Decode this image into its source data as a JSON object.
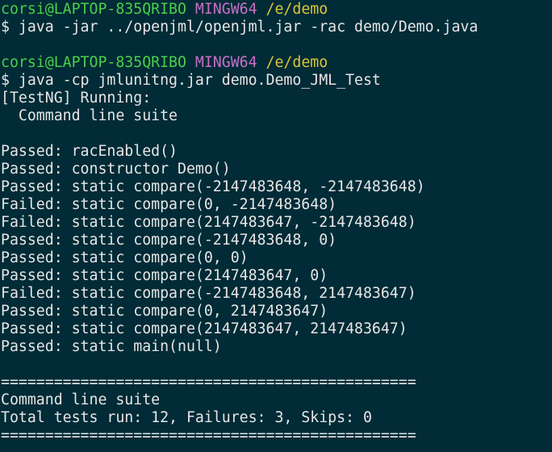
{
  "window": {
    "background": "#012b36",
    "colors": {
      "user": "#4ad04a",
      "env": "#c76fc7",
      "path": "#d9c63a",
      "text": "#e6e6e6"
    }
  },
  "prompt1": {
    "user": "corsi@LAPTOP-835QRIBO",
    "env": "MINGW64",
    "path": "/e/demo",
    "command": "$ java -jar ../openjml/openjml.jar -rac demo/Demo.java"
  },
  "prompt2": {
    "user": "corsi@LAPTOP-835QRIBO",
    "env": "MINGW64",
    "path": "/e/demo",
    "command": "$ java -cp jmlunitng.jar demo.Demo_JML_Test"
  },
  "testng": {
    "running": "[TestNG] Running:",
    "suite": "  Command line suite"
  },
  "results": [
    "Passed: racEnabled()",
    "Passed: constructor Demo()",
    "Passed: static compare(-2147483648, -2147483648)",
    "Failed: static compare(0, -2147483648)",
    "Failed: static compare(2147483647, -2147483648)",
    "Passed: static compare(-2147483648, 0)",
    "Passed: static compare(0, 0)",
    "Passed: static compare(2147483647, 0)",
    "Failed: static compare(-2147483648, 2147483647)",
    "Passed: static compare(0, 2147483647)",
    "Passed: static compare(2147483647, 2147483647)",
    "Passed: static main(null)"
  ],
  "summary": {
    "separator": "===============================================",
    "suite": "Command line suite",
    "totals": "Total tests run: 12, Failures: 3, Skips: 0",
    "separator_end": "==============================================="
  }
}
